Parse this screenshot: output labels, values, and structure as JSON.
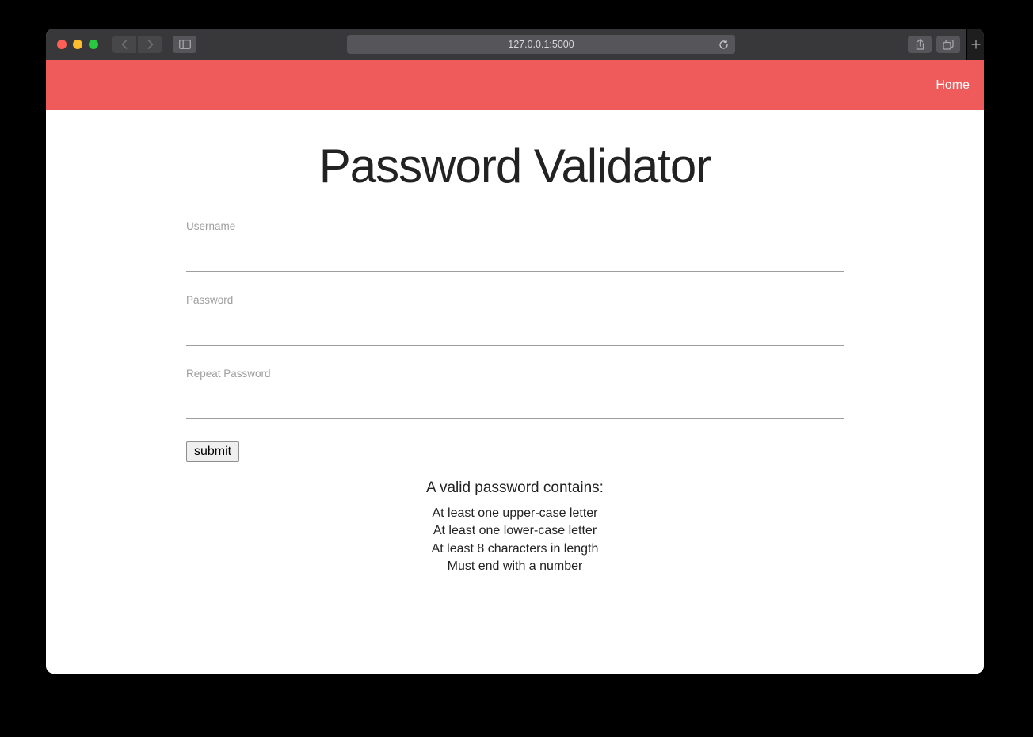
{
  "browser": {
    "url": "127.0.0.1:5000"
  },
  "navbar": {
    "home_label": "Home"
  },
  "page": {
    "title": "Password Validator"
  },
  "form": {
    "username_label": "Username",
    "username_value": "",
    "password_label": "Password",
    "password_value": "",
    "repeat_password_label": "Repeat Password",
    "repeat_password_value": "",
    "submit_label": "submit"
  },
  "rules": {
    "title": "A valid password contains:",
    "items": [
      "At least one upper-case letter",
      "At least one lower-case letter",
      "At least 8 characters in length",
      "Must end with a number"
    ]
  }
}
